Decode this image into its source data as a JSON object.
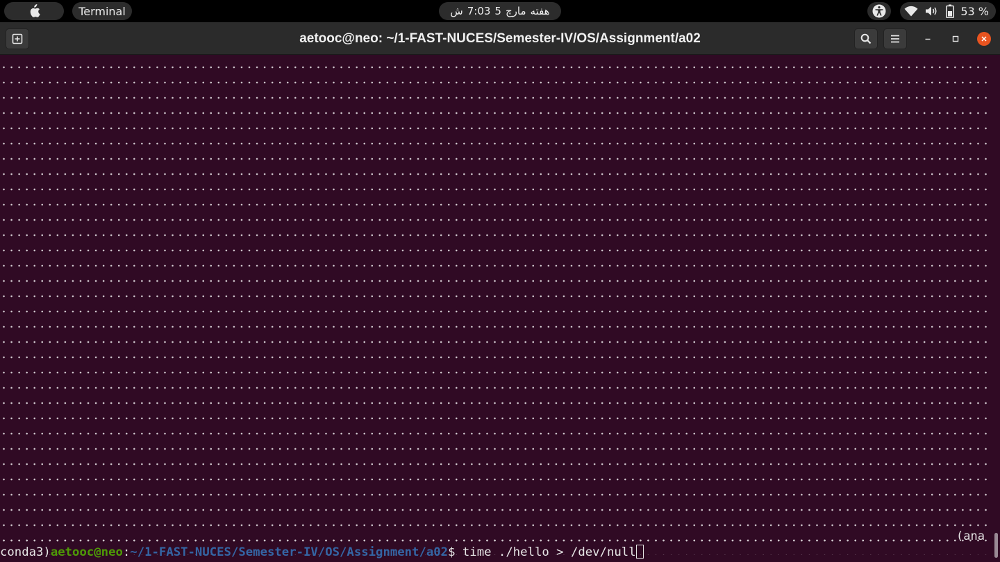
{
  "topbar": {
    "activities_icon": "apple-icon",
    "app_name": "Terminal",
    "clock": {
      "day": "هفته",
      "month": "مارچ",
      "date": "5",
      "time": "7:03",
      "ampm": "ش"
    },
    "battery_text": "53 %",
    "icons": [
      "accessibility-icon",
      "wifi-icon",
      "volume-icon",
      "battery-icon"
    ]
  },
  "window": {
    "title": "aetooc@neo: ~/1-FAST-NUCES/Semester-IV/OS/Assignment/a02",
    "buttons": [
      "new-tab-icon",
      "search-icon",
      "hamburger-menu-icon",
      "minimize-icon",
      "maximize-icon",
      "close-icon"
    ],
    "close_color": "#e95420"
  },
  "terminal": {
    "background": "#300a24",
    "wrap_tail": "(ana",
    "prompt": {
      "env": "conda3)",
      "user_host": "aetooc@neo",
      "separator": ":",
      "path": "~/1-FAST-NUCES/Semester-IV/OS/Assignment/a02",
      "symbol": "$",
      "command": " time ./hello > /dev/null"
    },
    "colors": {
      "user": "#4e9a06",
      "path": "#3465a4",
      "text": "#e6e6e6"
    }
  }
}
